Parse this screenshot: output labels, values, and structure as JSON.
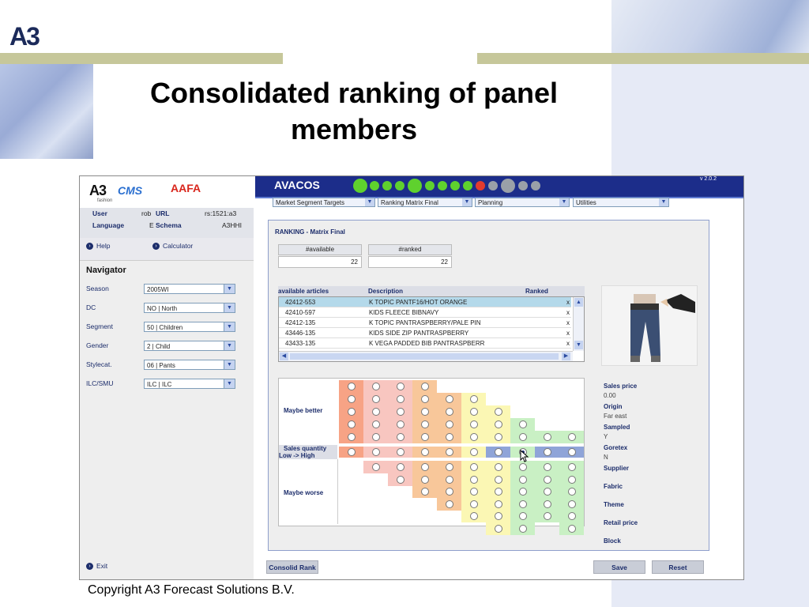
{
  "slide": {
    "logo": "A3",
    "title_line1": "Consolidated ranking of panel",
    "title_line2": "members",
    "copyright": "Copyright A3 Forecast Solutions B.V."
  },
  "app": {
    "brand_cms": "CMS",
    "brand_aafa": "AAFA",
    "brand_fashion": "fashion",
    "user_label": "User",
    "user_value": "rob",
    "url_label": "URL",
    "url_value": "rs:1521:a3",
    "language_label": "Language",
    "language_value": "E",
    "schema_label": "Schema",
    "schema_value": "A3HHI",
    "help_label": "Help",
    "calculator_label": "Calculator",
    "navigator_title": "Navigator",
    "nav_fields": [
      {
        "label": "Season",
        "value": "2005WI"
      },
      {
        "label": "DC",
        "value": "NO | North"
      },
      {
        "label": "Segment",
        "value": "50 | Children"
      },
      {
        "label": "Gender",
        "value": "2 | Child"
      },
      {
        "label": "Stylecat.",
        "value": "06 | Pants"
      },
      {
        "label": "ILC/SMU",
        "value": "ILC | ILC"
      }
    ],
    "exit_label": "Exit",
    "app_name": "AVACOS",
    "version": "v 2.0.2",
    "menus": [
      "Market Segment Targets",
      "Ranking Matrix Final",
      "Planning",
      "Utilities"
    ],
    "section_title": "RANKING - Matrix Final",
    "available_header": "#available",
    "available_value": "22",
    "ranked_header": "#ranked",
    "ranked_value": "22",
    "table_headers": {
      "articles": "available articles",
      "description": "Description",
      "ranked": "Ranked"
    },
    "articles": [
      {
        "id": "42412-553",
        "desc": "K TOPIC PANTF16/HOT ORANGE",
        "ranked": "x"
      },
      {
        "id": "42410-597",
        "desc": "KIDS FLEECE BIBNAVY",
        "ranked": "x"
      },
      {
        "id": "42412-135",
        "desc": "K TOPIC PANTRASPBERRY/PALE PIN",
        "ranked": "x"
      },
      {
        "id": "43446-135",
        "desc": "KIDS SIDE ZIP PANTRASPBERRY",
        "ranked": "x"
      },
      {
        "id": "43433-135",
        "desc": "K VEGA PADDED BIB PANTRASPBERR",
        "ranked": "x"
      }
    ],
    "matrix_labels": {
      "better": "Maybe better",
      "axis1": "Sales quantity",
      "axis2": "Low -> High",
      "worse": "Maybe worse"
    },
    "properties": [
      {
        "key": "Sales price",
        "value": "0.00"
      },
      {
        "key": "Origin",
        "value": "Far east"
      },
      {
        "key": "Sampled",
        "value": "Y"
      },
      {
        "key": "Goretex",
        "value": "N"
      },
      {
        "key": "Supplier",
        "value": ""
      },
      {
        "key": "Fabric",
        "value": ""
      },
      {
        "key": "Theme",
        "value": ""
      },
      {
        "key": "Retail price",
        "value": ""
      },
      {
        "key": "Block",
        "value": ""
      }
    ],
    "btn_consolid": "Consolid Rank",
    "btn_save": "Save",
    "btn_reset": "Reset",
    "colors": {
      "header_blue": "#1c2d8a",
      "matrix_red": "#f7a385",
      "matrix_pink": "#f8c6c0",
      "matrix_orange": "#f8c79a",
      "matrix_yellow": "#fbf7b4",
      "matrix_green": "#c9f0c4",
      "matrix_highlight": "#8fa4d8"
    }
  }
}
